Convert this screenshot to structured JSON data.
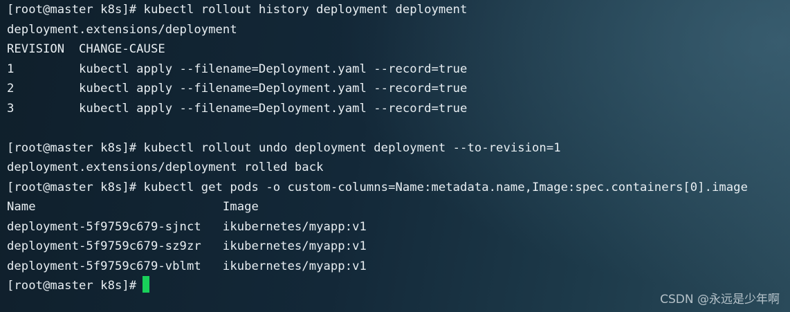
{
  "terminal": {
    "lines": [
      "[root@master k8s]# kubectl rollout history deployment deployment",
      "deployment.extensions/deployment",
      "REVISION  CHANGE-CAUSE",
      "1         kubectl apply --filename=Deployment.yaml --record=true",
      "2         kubectl apply --filename=Deployment.yaml --record=true",
      "3         kubectl apply --filename=Deployment.yaml --record=true",
      "",
      "[root@master k8s]# kubectl rollout undo deployment deployment --to-revision=1",
      "deployment.extensions/deployment rolled back",
      "[root@master k8s]# kubectl get pods -o custom-columns=Name:metadata.name,Image:spec.containers[0].image",
      "Name                          Image",
      "deployment-5f9759c679-sjnct   ikubernetes/myapp:v1",
      "deployment-5f9759c679-sz9zr   ikubernetes/myapp:v1",
      "deployment-5f9759c679-vblmt   ikubernetes/myapp:v1"
    ],
    "prompt": "[root@master k8s]#",
    "cursor_color": "#19d05a"
  },
  "watermark": "CSDN @永远是少年啊",
  "colors": {
    "text": "#e8eef2",
    "background_dark": "#0f1f2b",
    "background_light": "#2a4a5a"
  }
}
